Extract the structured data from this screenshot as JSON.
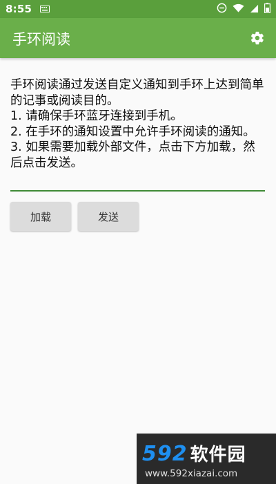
{
  "status_bar": {
    "time": "8:55"
  },
  "app_bar": {
    "title": "手环阅读",
    "settings_icon": "gear-icon"
  },
  "editor": {
    "text": "手环阅读通过发送自定义通知到手环上达到简单的记事或阅读目的。\n1. 请确保手环蓝牙连接到手机。\n2. 在手环的通知设置中允许手环阅读的通知。\n3. 如果需要加载外部文件，点击下方加载，然后点击发送。"
  },
  "buttons": {
    "load_label": "加载",
    "send_label": "发送"
  },
  "watermark": {
    "brand_number": "592",
    "brand_text": "软件园",
    "url": "www.592xiazai.com"
  },
  "colors": {
    "status_bar": "#5a9f3c",
    "app_bar": "#6aaf4a",
    "accent": "#3f8a36",
    "button": "#dcdcdc"
  }
}
